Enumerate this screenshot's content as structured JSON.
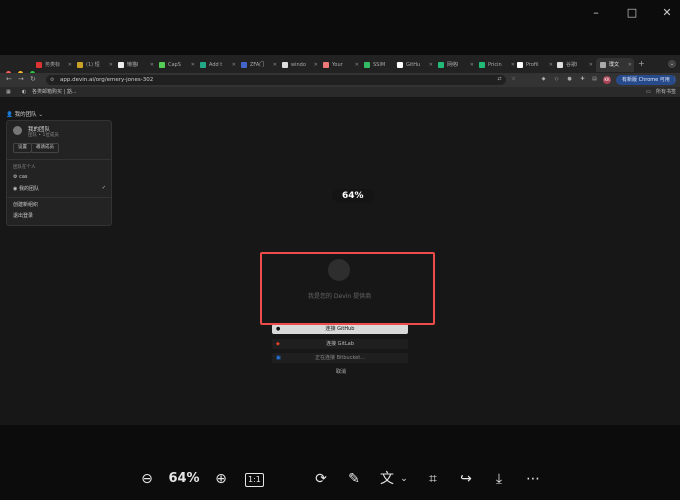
{
  "viewer": {
    "window_buttons": [
      "–",
      "□",
      "✕"
    ],
    "zoom_level": "64%",
    "fit_label": "1:1"
  },
  "browser": {
    "tabs": [
      {
        "label": "务类标"
      },
      {
        "label": "(1) 短"
      },
      {
        "label": "懒猫I"
      },
      {
        "label": "CapS"
      },
      {
        "label": "Add t"
      },
      {
        "label": "ZFA门"
      },
      {
        "label": "windo"
      },
      {
        "label": "Your"
      },
      {
        "label": "SSIM"
      },
      {
        "label": "GitHu"
      },
      {
        "label": "网络I"
      },
      {
        "label": "Pricin"
      },
      {
        "label": "Profil"
      },
      {
        "label": "谷歌I"
      },
      {
        "label": "璞文"
      }
    ],
    "new_tab": "+",
    "url": "app.devin.ai/org/emery-jones-302",
    "update_label": "有新版 Chrome 可用",
    "avatar_initials": "KK",
    "bookmark_item": "各类邮箱购买 | 豁...",
    "bookmarks_folder": "所有书签"
  },
  "team_menu": {
    "trigger": "我的团队",
    "team_name": "我的团队",
    "team_sub": "团队 • 1位成员",
    "settings": "设置",
    "invite": "邀请成员",
    "section_label": "团队在个人",
    "items": [
      "cas",
      "我的团队"
    ],
    "create": "创建新组织",
    "logout": "退出登录"
  },
  "main": {
    "loading_text": "我是您的 Devin 提供商"
  },
  "connect": {
    "github": "连接 GitHub",
    "gitlab": "连接 GitLab",
    "bitbucket": "正在连接 Bitbucket...",
    "cancel": "取消"
  },
  "colors": {
    "highlight": "#ee4b4b",
    "update_pill": "#274a8a"
  }
}
